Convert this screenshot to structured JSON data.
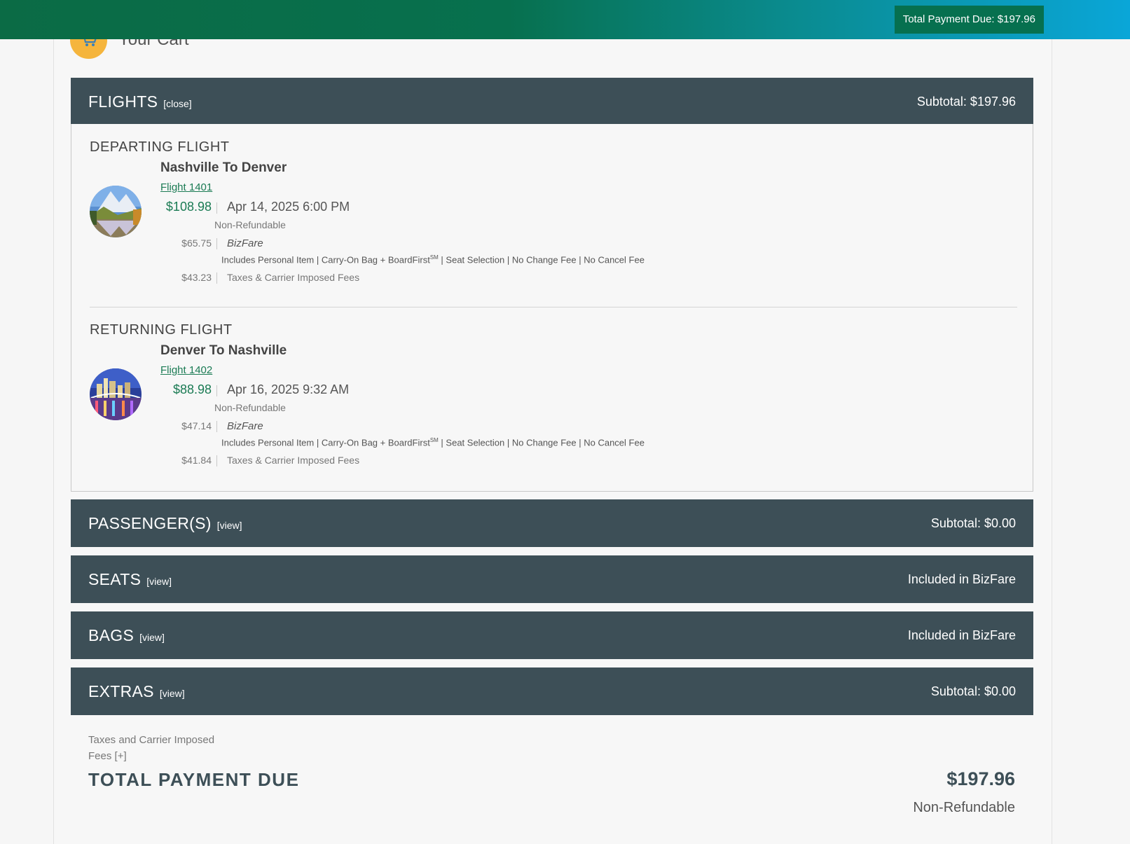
{
  "header": {
    "total_badge": "Total Payment Due: $197.96"
  },
  "cart": {
    "title": "Your Cart"
  },
  "sections": {
    "flights": {
      "title": "FLIGHTS",
      "toggle": "[close]",
      "right": "Subtotal: $197.96"
    },
    "passengers": {
      "title": "PASSENGER(S)",
      "toggle": "[view]",
      "right": "Subtotal: $0.00"
    },
    "seats": {
      "title": "SEATS",
      "toggle": "[view]",
      "right": "Included in BizFare"
    },
    "bags": {
      "title": "BAGS",
      "toggle": "[view]",
      "right": "Included in BizFare"
    },
    "extras": {
      "title": "EXTRAS",
      "toggle": "[view]",
      "right": "Subtotal: $0.00"
    }
  },
  "flights": {
    "departing": {
      "heading": "DEPARTING  FLIGHT",
      "route": "Nashville To Denver",
      "flight_number": "Flight 1401",
      "price": "$108.98",
      "datetime": "Apr 14, 2025 6:00 PM",
      "refund_policy": "Non-Refundable",
      "fare_amount": "$65.75",
      "fare_name": "BizFare",
      "includes": "Includes Personal Item | Carry-On Bag + BoardFirst",
      "includes_sup": "SM",
      "includes_rest": " | Seat Selection | No Change Fee | No Cancel Fee",
      "taxes_amount": "$43.23",
      "taxes_label": "Taxes & Carrier Imposed Fees",
      "photo_icon": "mountain-photo-icon"
    },
    "returning": {
      "heading": "RETURNING  FLIGHT",
      "route": "Denver To Nashville",
      "flight_number": "Flight 1402",
      "price": "$88.98",
      "datetime": "Apr 16, 2025 9:32 AM",
      "refund_policy": "Non-Refundable",
      "fare_amount": "$47.14",
      "fare_name": "BizFare",
      "includes": "Includes Personal Item | Carry-On Bag + BoardFirst",
      "includes_sup": "SM",
      "includes_rest": " | Seat Selection | No Change Fee | No Cancel Fee",
      "taxes_amount": "$41.84",
      "taxes_label": "Taxes & Carrier Imposed Fees",
      "photo_icon": "city-skyline-photo-icon"
    }
  },
  "footer": {
    "fees_label": "Taxes and Carrier Imposed",
    "fees_label_2": "Fees",
    "fees_expand": "[+]",
    "total_label": "TOTAL PAYMENT DUE",
    "total_amount": "$197.96",
    "total_refund": "Non-Refundable"
  },
  "colors": {
    "accent_green": "#1b7b54",
    "section_bar": "#3d4f57",
    "cart_icon": "#f5b53d"
  }
}
